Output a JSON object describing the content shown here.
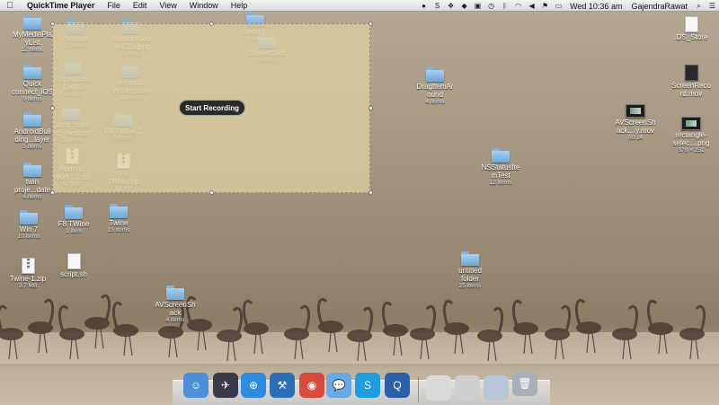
{
  "menubar": {
    "apple": "",
    "app_name": "QuickTime Player",
    "menus": [
      "File",
      "Edit",
      "View",
      "Window",
      "Help"
    ],
    "clock": "Wed 10:36 am",
    "user": "GajendraRawat"
  },
  "recording": {
    "button_label": "Start Recording"
  },
  "desktop_icons": [
    {
      "label": "MyMediaPlaylist",
      "line1": "MyMediaPla",
      "line2": "yList",
      "sub": "12 items",
      "kind": "folder"
    },
    {
      "label": "Quick connect_iOS",
      "line1": "Quick",
      "line2": "connect_iOS",
      "sub": "9 items",
      "kind": "folder"
    },
    {
      "label": "AndroidBuilding...layer",
      "line1": "AndroidBuil",
      "line2": "ding...layer",
      "sub": "3 items",
      "kind": "folder"
    },
    {
      "label": "twin proje...date",
      "line1": "twin",
      "line2": "proje...date",
      "sub": "4 items",
      "kind": "folder"
    },
    {
      "label": "Win 7",
      "line1": "Win 7",
      "line2": "",
      "sub": "10 items",
      "kind": "folder"
    },
    {
      "label": "Twine-1.zip",
      "line1": "Twine-1.zip",
      "line2": "",
      "sub": "3.7 MB",
      "kind": "zip"
    },
    {
      "label": "Android",
      "line1": "Android",
      "line2": "",
      "sub": "21 items",
      "kind": "folder"
    },
    {
      "label": "Animations Demo",
      "line1": "Animations",
      "line2": "Demo",
      "sub": "4 items",
      "kind": "folder"
    },
    {
      "label": "Quick_connect_Android",
      "line1": "Quick_conn",
      "line2": "ect_Android",
      "sub": "11 items",
      "kind": "folder"
    },
    {
      "label": "Android Work...1.zip",
      "line1": "Android",
      "line2": "Work...1.zip",
      "sub": "4.7 MB",
      "kind": "zip"
    },
    {
      "label": "F8 TWine",
      "line1": "F8 TWine",
      "line2": "",
      "sub": "1 item",
      "kind": "folder"
    },
    {
      "label": "script.sh",
      "line1": "script.sh",
      "line2": "",
      "sub": "",
      "kind": "doc"
    },
    {
      "label": "AndroidGooglePackaging",
      "line1": "AndroidGoo",
      "line2": "gleC...aging",
      "sub": "5 items",
      "kind": "folder"
    },
    {
      "label": "Android Workspace",
      "line1": "Android",
      "line2": "Workspace",
      "sub": "19 items",
      "kind": "folder"
    },
    {
      "label": "F8 TWine 2",
      "line1": "F8 TWine 2",
      "line2": "",
      "sub": "2 items",
      "kind": "folder"
    },
    {
      "label": "F8 TWine.zip",
      "line1": "F8",
      "line2": "TWine.zip",
      "sub": "2.2 MB",
      "kind": "zip"
    },
    {
      "label": "Twine",
      "line1": "Twine",
      "line2": "",
      "sub": "13 items",
      "kind": "folder"
    },
    {
      "label": "Session",
      "line1": "Session",
      "line2": "",
      "sub": "9 items",
      "kind": "folder"
    },
    {
      "label": "ScreenShot",
      "line1": "ScreenShot",
      "line2": "",
      "sub": "8 items",
      "kind": "folder"
    },
    {
      "label": "AVScreenShack",
      "line1": "AVScreenSh",
      "line2": "ack",
      "sub": "4 items",
      "kind": "folder"
    },
    {
      "label": "DragItemAround",
      "line1": "DragItemAr",
      "line2": "ound",
      "sub": "4 items",
      "kind": "folder"
    },
    {
      "label": "NSStatusItemTest",
      "line1": "NSStatusIte",
      "line2": "mTest",
      "sub": "12 items",
      "kind": "folder"
    },
    {
      "label": "untitled folder",
      "line1": "untitled",
      "line2": "folder",
      "sub": "25 items",
      "kind": "folder"
    },
    {
      "label": "AVScreenShack...y.mov",
      "line1": "AVScreenSh",
      "line2": "ack....y.mov",
      "sub": "00:14",
      "kind": "movie"
    },
    {
      "label": ".DS_Store",
      "line1": ".DS_Store",
      "line2": "",
      "sub": "",
      "kind": "doc"
    },
    {
      "label": "ScreenRecord.mov",
      "line1": "ScreenReco",
      "line2": "rd.mov",
      "sub": "",
      "kind": "docdark"
    },
    {
      "label": "rectangle-selec....png",
      "line1": "rectangle-",
      "line2": "selec....png",
      "sub": "378 × 251",
      "kind": "movie"
    }
  ],
  "dock": [
    {
      "name": "Finder",
      "glyph": "☺",
      "color": "#4a8fd8"
    },
    {
      "name": "Launchpad",
      "glyph": "✈",
      "color": "#3a3a4a"
    },
    {
      "name": "Safari",
      "glyph": "⊕",
      "color": "#2e8be0"
    },
    {
      "name": "Xcode",
      "glyph": "⚒",
      "color": "#2c6fb8"
    },
    {
      "name": "Chrome",
      "glyph": "◉",
      "color": "#d84b3c"
    },
    {
      "name": "Messages",
      "glyph": "💬",
      "color": "#6aa9e8"
    },
    {
      "name": "Skype",
      "glyph": "S",
      "color": "#1d9ee0"
    },
    {
      "name": "QuickTime Player",
      "glyph": "Q",
      "color": "#2b5fa8"
    },
    {
      "name": "Downloads",
      "glyph": "",
      "color": "#d9d9d9"
    },
    {
      "name": "Documents",
      "glyph": "",
      "color": "#cfcfcf"
    },
    {
      "name": "Applications",
      "glyph": "",
      "color": "#b9c8d9"
    },
    {
      "name": "Trash",
      "glyph": "🗑",
      "color": "#aab0b8"
    }
  ]
}
